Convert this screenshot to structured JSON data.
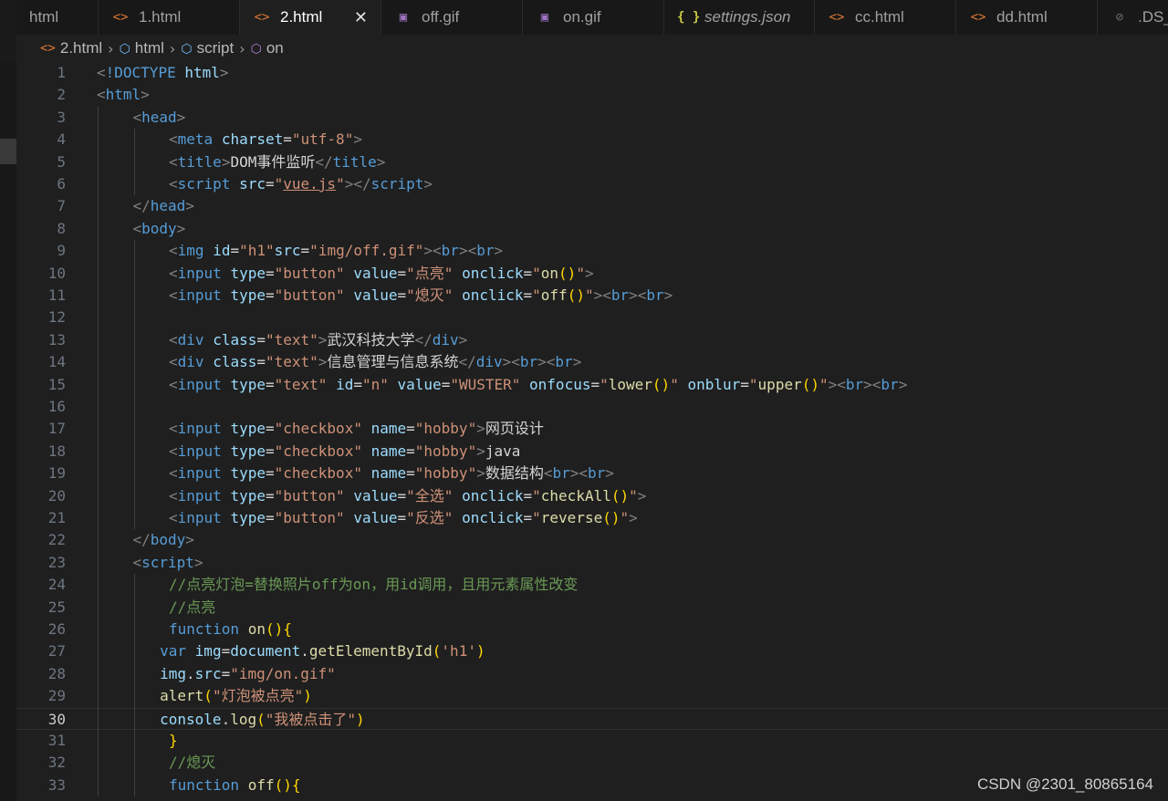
{
  "tabs": [
    {
      "label": "html",
      "icon": "none",
      "active": false
    },
    {
      "label": "1.html",
      "icon": "html",
      "active": false
    },
    {
      "label": "2.html",
      "icon": "html",
      "active": true
    },
    {
      "label": "off.gif",
      "icon": "img",
      "active": false
    },
    {
      "label": "on.gif",
      "icon": "img",
      "active": false
    },
    {
      "label": "settings.json",
      "icon": "json",
      "active": false
    },
    {
      "label": "cc.html",
      "icon": "html",
      "active": false
    },
    {
      "label": "dd.html",
      "icon": "html",
      "active": false
    },
    {
      "label": ".DS_S",
      "icon": "hidden",
      "active": false
    }
  ],
  "breadcrumb": [
    "2.html",
    "html",
    "script",
    "on"
  ],
  "current_line": 30,
  "watermark": "CSDN @2301_80865164",
  "lines": [
    {
      "n": 1,
      "indent": 0,
      "t": [
        [
          "p",
          "<"
        ],
        [
          "t",
          "!DOCTYPE"
        ],
        [
          "tx",
          " "
        ],
        [
          "a",
          "html"
        ],
        [
          "p",
          ">"
        ]
      ]
    },
    {
      "n": 2,
      "indent": 0,
      "t": [
        [
          "p",
          "<"
        ],
        [
          "t",
          "html"
        ],
        [
          "p",
          ">"
        ]
      ]
    },
    {
      "n": 3,
      "indent": 1,
      "t": [
        [
          "p",
          "<"
        ],
        [
          "t",
          "head"
        ],
        [
          "p",
          ">"
        ]
      ]
    },
    {
      "n": 4,
      "indent": 2,
      "t": [
        [
          "p",
          "<"
        ],
        [
          "t",
          "meta"
        ],
        [
          "tx",
          " "
        ],
        [
          "a",
          "charset"
        ],
        [
          "tx",
          "="
        ],
        [
          "s",
          "\"utf-8\""
        ],
        [
          "p",
          ">"
        ]
      ]
    },
    {
      "n": 5,
      "indent": 2,
      "t": [
        [
          "p",
          "<"
        ],
        [
          "t",
          "title"
        ],
        [
          "p",
          ">"
        ],
        [
          "tx",
          "DOM事件监听"
        ],
        [
          "p",
          "</"
        ],
        [
          "t",
          "title"
        ],
        [
          "p",
          ">"
        ]
      ]
    },
    {
      "n": 6,
      "indent": 2,
      "t": [
        [
          "p",
          "<"
        ],
        [
          "t",
          "script"
        ],
        [
          "tx",
          " "
        ],
        [
          "a",
          "src"
        ],
        [
          "tx",
          "="
        ],
        [
          "s",
          "\""
        ],
        [
          "su",
          "vue.js"
        ],
        [
          "s",
          "\""
        ],
        [
          "p",
          "></"
        ],
        [
          "t",
          "script"
        ],
        [
          "p",
          ">"
        ]
      ]
    },
    {
      "n": 7,
      "indent": 1,
      "t": [
        [
          "p",
          "</"
        ],
        [
          "t",
          "head"
        ],
        [
          "p",
          ">"
        ]
      ]
    },
    {
      "n": 8,
      "indent": 1,
      "t": [
        [
          "p",
          "<"
        ],
        [
          "t",
          "body"
        ],
        [
          "p",
          ">"
        ]
      ]
    },
    {
      "n": 9,
      "indent": 2,
      "t": [
        [
          "p",
          "<"
        ],
        [
          "t",
          "img"
        ],
        [
          "tx",
          " "
        ],
        [
          "a",
          "id"
        ],
        [
          "tx",
          "="
        ],
        [
          "s",
          "\"h1\""
        ],
        [
          "a",
          "src"
        ],
        [
          "tx",
          "="
        ],
        [
          "s",
          "\"img/off.gif\""
        ],
        [
          "p",
          "><"
        ],
        [
          "t",
          "br"
        ],
        [
          "p",
          "><"
        ],
        [
          "t",
          "br"
        ],
        [
          "p",
          ">"
        ]
      ]
    },
    {
      "n": 10,
      "indent": 2,
      "t": [
        [
          "p",
          "<"
        ],
        [
          "t",
          "input"
        ],
        [
          "tx",
          " "
        ],
        [
          "a",
          "type"
        ],
        [
          "tx",
          "="
        ],
        [
          "s",
          "\"button\""
        ],
        [
          "tx",
          " "
        ],
        [
          "a",
          "value"
        ],
        [
          "tx",
          "="
        ],
        [
          "s",
          "\"点亮\""
        ],
        [
          "tx",
          " "
        ],
        [
          "a",
          "onclick"
        ],
        [
          "tx",
          "="
        ],
        [
          "s",
          "\""
        ],
        [
          "f",
          "on"
        ],
        [
          "b",
          "()"
        ],
        [
          "s",
          "\""
        ],
        [
          "p",
          ">"
        ]
      ]
    },
    {
      "n": 11,
      "indent": 2,
      "t": [
        [
          "p",
          "<"
        ],
        [
          "t",
          "input"
        ],
        [
          "tx",
          " "
        ],
        [
          "a",
          "type"
        ],
        [
          "tx",
          "="
        ],
        [
          "s",
          "\"button\""
        ],
        [
          "tx",
          " "
        ],
        [
          "a",
          "value"
        ],
        [
          "tx",
          "="
        ],
        [
          "s",
          "\"熄灭\""
        ],
        [
          "tx",
          " "
        ],
        [
          "a",
          "onclick"
        ],
        [
          "tx",
          "="
        ],
        [
          "s",
          "\""
        ],
        [
          "f",
          "off"
        ],
        [
          "b",
          "()"
        ],
        [
          "s",
          "\""
        ],
        [
          "p",
          "><"
        ],
        [
          "t",
          "br"
        ],
        [
          "p",
          "><"
        ],
        [
          "t",
          "br"
        ],
        [
          "p",
          ">"
        ]
      ]
    },
    {
      "n": 12,
      "indent": 2,
      "t": []
    },
    {
      "n": 13,
      "indent": 2,
      "t": [
        [
          "p",
          "<"
        ],
        [
          "t",
          "div"
        ],
        [
          "tx",
          " "
        ],
        [
          "a",
          "class"
        ],
        [
          "tx",
          "="
        ],
        [
          "s",
          "\"text\""
        ],
        [
          "p",
          ">"
        ],
        [
          "tx",
          "武汉科技大学"
        ],
        [
          "p",
          "</"
        ],
        [
          "t",
          "div"
        ],
        [
          "p",
          ">"
        ]
      ]
    },
    {
      "n": 14,
      "indent": 2,
      "t": [
        [
          "p",
          "<"
        ],
        [
          "t",
          "div"
        ],
        [
          "tx",
          " "
        ],
        [
          "a",
          "class"
        ],
        [
          "tx",
          "="
        ],
        [
          "s",
          "\"text\""
        ],
        [
          "p",
          ">"
        ],
        [
          "tx",
          "信息管理与信息系统"
        ],
        [
          "p",
          "</"
        ],
        [
          "t",
          "div"
        ],
        [
          "p",
          "><"
        ],
        [
          "t",
          "br"
        ],
        [
          "p",
          "><"
        ],
        [
          "t",
          "br"
        ],
        [
          "p",
          ">"
        ]
      ]
    },
    {
      "n": 15,
      "indent": 2,
      "t": [
        [
          "p",
          "<"
        ],
        [
          "t",
          "input"
        ],
        [
          "tx",
          " "
        ],
        [
          "a",
          "type"
        ],
        [
          "tx",
          "="
        ],
        [
          "s",
          "\"text\""
        ],
        [
          "tx",
          " "
        ],
        [
          "a",
          "id"
        ],
        [
          "tx",
          "="
        ],
        [
          "s",
          "\"n\""
        ],
        [
          "tx",
          " "
        ],
        [
          "a",
          "value"
        ],
        [
          "tx",
          "="
        ],
        [
          "s",
          "\"WUSTER\""
        ],
        [
          "tx",
          " "
        ],
        [
          "a",
          "onfocus"
        ],
        [
          "tx",
          "="
        ],
        [
          "s",
          "\""
        ],
        [
          "f",
          "lower"
        ],
        [
          "b",
          "()"
        ],
        [
          "s",
          "\""
        ],
        [
          "tx",
          " "
        ],
        [
          "a",
          "onblur"
        ],
        [
          "tx",
          "="
        ],
        [
          "s",
          "\""
        ],
        [
          "f",
          "upper"
        ],
        [
          "b",
          "()"
        ],
        [
          "s",
          "\""
        ],
        [
          "p",
          "><"
        ],
        [
          "t",
          "br"
        ],
        [
          "p",
          "><"
        ],
        [
          "t",
          "br"
        ],
        [
          "p",
          ">"
        ]
      ]
    },
    {
      "n": 16,
      "indent": 2,
      "t": []
    },
    {
      "n": 17,
      "indent": 2,
      "t": [
        [
          "p",
          "<"
        ],
        [
          "t",
          "input"
        ],
        [
          "tx",
          " "
        ],
        [
          "a",
          "type"
        ],
        [
          "tx",
          "="
        ],
        [
          "s",
          "\"checkbox\""
        ],
        [
          "tx",
          " "
        ],
        [
          "a",
          "name"
        ],
        [
          "tx",
          "="
        ],
        [
          "s",
          "\"hobby\""
        ],
        [
          "p",
          ">"
        ],
        [
          "tx",
          "网页设计"
        ]
      ]
    },
    {
      "n": 18,
      "indent": 2,
      "t": [
        [
          "p",
          "<"
        ],
        [
          "t",
          "input"
        ],
        [
          "tx",
          " "
        ],
        [
          "a",
          "type"
        ],
        [
          "tx",
          "="
        ],
        [
          "s",
          "\"checkbox\""
        ],
        [
          "tx",
          " "
        ],
        [
          "a",
          "name"
        ],
        [
          "tx",
          "="
        ],
        [
          "s",
          "\"hobby\""
        ],
        [
          "p",
          ">"
        ],
        [
          "tx",
          "java"
        ]
      ]
    },
    {
      "n": 19,
      "indent": 2,
      "t": [
        [
          "p",
          "<"
        ],
        [
          "t",
          "input"
        ],
        [
          "tx",
          " "
        ],
        [
          "a",
          "type"
        ],
        [
          "tx",
          "="
        ],
        [
          "s",
          "\"checkbox\""
        ],
        [
          "tx",
          " "
        ],
        [
          "a",
          "name"
        ],
        [
          "tx",
          "="
        ],
        [
          "s",
          "\"hobby\""
        ],
        [
          "p",
          ">"
        ],
        [
          "tx",
          "数据结构"
        ],
        [
          "p",
          "<"
        ],
        [
          "t",
          "br"
        ],
        [
          "p",
          "><"
        ],
        [
          "t",
          "br"
        ],
        [
          "p",
          ">"
        ]
      ]
    },
    {
      "n": 20,
      "indent": 2,
      "t": [
        [
          "p",
          "<"
        ],
        [
          "t",
          "input"
        ],
        [
          "tx",
          " "
        ],
        [
          "a",
          "type"
        ],
        [
          "tx",
          "="
        ],
        [
          "s",
          "\"button\""
        ],
        [
          "tx",
          " "
        ],
        [
          "a",
          "value"
        ],
        [
          "tx",
          "="
        ],
        [
          "s",
          "\"全选\""
        ],
        [
          "tx",
          " "
        ],
        [
          "a",
          "onclick"
        ],
        [
          "tx",
          "="
        ],
        [
          "s",
          "\""
        ],
        [
          "f",
          "checkAll"
        ],
        [
          "b",
          "()"
        ],
        [
          "s",
          "\""
        ],
        [
          "p",
          ">"
        ]
      ]
    },
    {
      "n": 21,
      "indent": 2,
      "t": [
        [
          "p",
          "<"
        ],
        [
          "t",
          "input"
        ],
        [
          "tx",
          " "
        ],
        [
          "a",
          "type"
        ],
        [
          "tx",
          "="
        ],
        [
          "s",
          "\"button\""
        ],
        [
          "tx",
          " "
        ],
        [
          "a",
          "value"
        ],
        [
          "tx",
          "="
        ],
        [
          "s",
          "\"反选\""
        ],
        [
          "tx",
          " "
        ],
        [
          "a",
          "onclick"
        ],
        [
          "tx",
          "="
        ],
        [
          "s",
          "\""
        ],
        [
          "f",
          "reverse"
        ],
        [
          "b",
          "()"
        ],
        [
          "s",
          "\""
        ],
        [
          "p",
          ">"
        ]
      ]
    },
    {
      "n": 22,
      "indent": 1,
      "t": [
        [
          "p",
          "</"
        ],
        [
          "t",
          "body"
        ],
        [
          "p",
          ">"
        ]
      ]
    },
    {
      "n": 23,
      "indent": 1,
      "t": [
        [
          "p",
          "<"
        ],
        [
          "t",
          "script"
        ],
        [
          "p",
          ">"
        ]
      ]
    },
    {
      "n": 24,
      "indent": 2,
      "t": [
        [
          "c",
          "//点亮灯泡=替换照片off为on，用id调用，且用元素属性改变"
        ]
      ]
    },
    {
      "n": 25,
      "indent": 2,
      "t": [
        [
          "c",
          "//点亮"
        ]
      ]
    },
    {
      "n": 26,
      "indent": 2,
      "t": [
        [
          "k",
          "function"
        ],
        [
          "tx",
          " "
        ],
        [
          "f",
          "on"
        ],
        [
          "b",
          "(){"
        ]
      ]
    },
    {
      "n": 27,
      "indent": 1.75,
      "t": [
        [
          "k",
          "var"
        ],
        [
          "tx",
          " "
        ],
        [
          "a",
          "img"
        ],
        [
          "tx",
          "="
        ],
        [
          "a",
          "document"
        ],
        [
          "tx",
          "."
        ],
        [
          "f",
          "getElementById"
        ],
        [
          "b",
          "("
        ],
        [
          "s",
          "'h1'"
        ],
        [
          "b",
          ")"
        ]
      ]
    },
    {
      "n": 28,
      "indent": 1.75,
      "t": [
        [
          "a",
          "img"
        ],
        [
          "tx",
          "."
        ],
        [
          "a",
          "src"
        ],
        [
          "tx",
          "="
        ],
        [
          "s",
          "\"img/on.gif\""
        ]
      ]
    },
    {
      "n": 29,
      "indent": 1.75,
      "t": [
        [
          "f",
          "alert"
        ],
        [
          "b",
          "("
        ],
        [
          "s",
          "\"灯泡被点亮\""
        ],
        [
          "b",
          ")"
        ]
      ]
    },
    {
      "n": 30,
      "indent": 1.75,
      "t": [
        [
          "a",
          "console"
        ],
        [
          "tx",
          "."
        ],
        [
          "f",
          "log"
        ],
        [
          "b",
          "("
        ],
        [
          "s",
          "\"我被点击了\""
        ],
        [
          "b",
          ")"
        ]
      ]
    },
    {
      "n": 31,
      "indent": 2,
      "t": [
        [
          "b",
          "}"
        ]
      ]
    },
    {
      "n": 32,
      "indent": 2,
      "t": [
        [
          "c",
          "//熄灭"
        ]
      ]
    },
    {
      "n": 33,
      "indent": 2,
      "t": [
        [
          "k",
          "function"
        ],
        [
          "tx",
          " "
        ],
        [
          "f",
          "off"
        ],
        [
          "b",
          "(){"
        ]
      ]
    }
  ]
}
